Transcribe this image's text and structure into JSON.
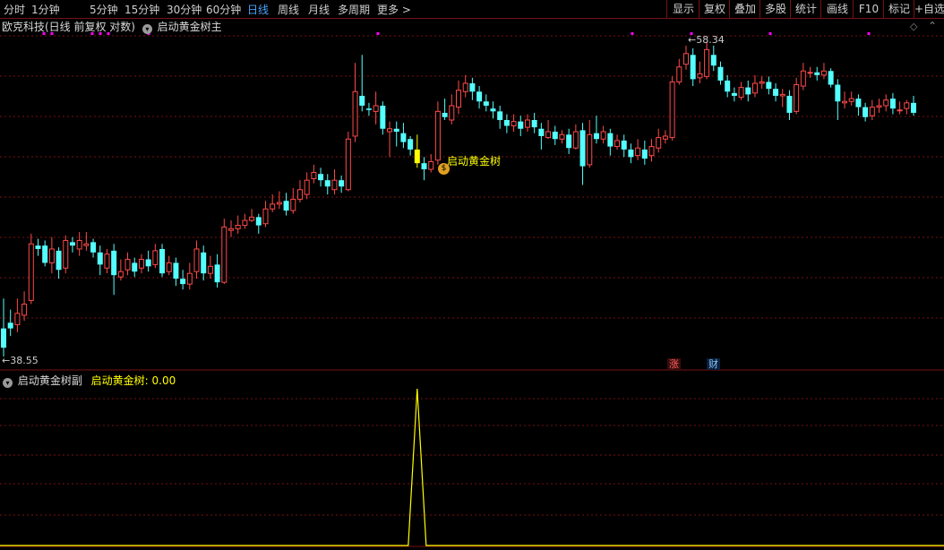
{
  "toolbar": {
    "periods": [
      "分时",
      "1分钟",
      "5分钟",
      "15分钟",
      "30分钟",
      "60分钟",
      "日线",
      "周线",
      "月线",
      "多周期",
      "更多 >"
    ],
    "active_period": "日线",
    "buttons": [
      "显示",
      "复权",
      "叠加",
      "多股",
      "统计",
      "画线",
      "F10",
      "标记",
      "+自选"
    ]
  },
  "main_chart": {
    "stock_title": "欧克科技(日线 前复权 对数)",
    "indicator_name": "启动黄金树主",
    "high_label": "58.34",
    "low_label": "38.55",
    "signal_text": "启动黄金树",
    "tags": [
      "涨",
      "财"
    ]
  },
  "sub_chart": {
    "indicator_name": "启动黄金树副",
    "value_label": "启动黄金树: 0.00"
  },
  "colors": {
    "up": "#ff4a4a",
    "down": "#54ffff",
    "signal": "#ffff00",
    "grid": "#7a1010",
    "marker": "#ff00ff"
  },
  "chart_data": {
    "type": "candlestick",
    "price_range": [
      38.55,
      58.34
    ],
    "candles": [
      [
        40.0,
        39.0,
        41.6,
        38.55
      ],
      [
        40.3,
        40.0,
        41.0,
        39.6
      ],
      [
        40.2,
        40.8,
        41.6,
        39.8
      ],
      [
        40.7,
        41.3,
        42.0,
        40.4
      ],
      [
        41.5,
        44.7,
        45.3,
        41.3
      ],
      [
        44.6,
        44.4,
        45.0,
        44.0
      ],
      [
        44.6,
        43.6,
        44.9,
        43.4
      ],
      [
        43.6,
        44.4,
        45.1,
        43.0
      ],
      [
        44.3,
        43.2,
        44.5,
        42.7
      ],
      [
        43.3,
        44.9,
        45.2,
        43.0
      ],
      [
        44.8,
        44.6,
        45.1,
        44.2
      ],
      [
        44.4,
        44.9,
        45.4,
        44.0
      ],
      [
        44.6,
        44.7,
        45.4,
        44.3
      ],
      [
        44.8,
        44.2,
        45.0,
        43.9
      ],
      [
        44.2,
        43.5,
        44.6,
        42.9
      ],
      [
        43.3,
        44.1,
        44.4,
        43.0
      ],
      [
        44.3,
        42.9,
        44.7,
        41.8
      ],
      [
        42.8,
        43.1,
        43.8,
        42.6
      ],
      [
        43.2,
        43.8,
        44.2,
        42.9
      ],
      [
        43.6,
        43.1,
        43.9,
        42.8
      ],
      [
        43.3,
        43.8,
        44.1,
        43.0
      ],
      [
        43.8,
        43.4,
        44.3,
        43.1
      ],
      [
        43.5,
        44.3,
        44.7,
        43.3
      ],
      [
        44.4,
        43.0,
        44.7,
        42.8
      ],
      [
        43.1,
        43.6,
        44.0,
        42.9
      ],
      [
        43.6,
        42.7,
        43.9,
        42.3
      ],
      [
        42.7,
        42.4,
        43.2,
        42.1
      ],
      [
        42.4,
        43.0,
        43.6,
        42.1
      ],
      [
        43.1,
        44.4,
        44.9,
        42.7
      ],
      [
        44.2,
        43.0,
        44.6,
        42.6
      ],
      [
        43.0,
        43.4,
        44.0,
        42.7
      ],
      [
        43.5,
        42.5,
        44.1,
        42.2
      ],
      [
        42.5,
        45.7,
        46.2,
        42.4
      ],
      [
        45.5,
        45.6,
        46.1,
        45.1
      ],
      [
        45.6,
        45.8,
        46.4,
        45.3
      ],
      [
        45.8,
        46.1,
        46.5,
        45.6
      ],
      [
        46.1,
        46.3,
        46.8,
        46.0
      ],
      [
        46.3,
        45.8,
        46.5,
        45.3
      ],
      [
        45.9,
        46.8,
        47.3,
        45.7
      ],
      [
        46.8,
        47.1,
        47.7,
        46.6
      ],
      [
        47.1,
        47.2,
        47.9,
        46.8
      ],
      [
        47.3,
        46.7,
        47.8,
        46.4
      ],
      [
        46.7,
        47.4,
        48.1,
        46.5
      ],
      [
        47.4,
        48.0,
        48.6,
        47.2
      ],
      [
        47.7,
        48.6,
        49.1,
        47.4
      ],
      [
        48.7,
        49.1,
        49.6,
        48.4
      ],
      [
        49.0,
        48.6,
        49.4,
        48.2
      ],
      [
        48.6,
        48.2,
        49.0,
        47.7
      ],
      [
        48.0,
        48.6,
        49.3,
        47.7
      ],
      [
        48.6,
        48.2,
        48.9,
        47.8
      ],
      [
        48.0,
        51.3,
        51.8,
        47.9
      ],
      [
        51.5,
        54.6,
        56.7,
        51.1
      ],
      [
        54.3,
        53.6,
        57.3,
        53.2
      ],
      [
        53.4,
        53.3,
        53.8,
        52.9
      ],
      [
        53.2,
        53.6,
        54.6,
        52.3
      ],
      [
        53.6,
        52.0,
        53.9,
        51.6
      ],
      [
        51.8,
        52.0,
        52.5,
        50.1
      ],
      [
        52.0,
        51.8,
        52.5,
        50.8
      ],
      [
        51.7,
        51.1,
        52.4,
        50.7
      ],
      [
        51.3,
        50.6,
        51.5,
        50.2
      ],
      [
        50.6,
        49.7,
        51.6,
        49.4
      ],
      [
        49.7,
        49.3,
        50.1,
        48.6
      ],
      [
        49.3,
        49.8,
        50.3,
        49.1
      ],
      [
        49.9,
        53.2,
        53.9,
        49.6
      ],
      [
        53.1,
        52.8,
        54.1,
        52.6
      ],
      [
        52.6,
        53.6,
        54.4,
        52.3
      ],
      [
        53.5,
        54.7,
        55.4,
        53.0
      ],
      [
        54.6,
        55.2,
        55.8,
        54.2
      ],
      [
        55.2,
        54.6,
        55.6,
        54.0
      ],
      [
        54.6,
        53.9,
        55.0,
        53.4
      ],
      [
        53.9,
        53.6,
        54.4,
        53.2
      ],
      [
        53.4,
        53.2,
        53.9,
        52.7
      ],
      [
        53.2,
        52.6,
        53.6,
        52.0
      ],
      [
        52.6,
        52.2,
        53.0,
        51.7
      ],
      [
        52.2,
        52.5,
        53.0,
        51.8
      ],
      [
        52.5,
        52.0,
        52.9,
        51.5
      ],
      [
        52.1,
        52.6,
        53.0,
        51.8
      ],
      [
        52.6,
        52.1,
        53.1,
        51.7
      ],
      [
        52.0,
        51.5,
        52.4,
        50.6
      ],
      [
        51.4,
        51.8,
        52.6,
        51.3
      ],
      [
        51.8,
        51.3,
        52.2,
        50.9
      ],
      [
        51.3,
        51.6,
        51.9,
        51.0
      ],
      [
        51.6,
        50.7,
        52.0,
        50.3
      ],
      [
        50.7,
        51.8,
        52.3,
        50.6
      ],
      [
        51.9,
        49.5,
        52.4,
        48.3
      ],
      [
        49.6,
        51.6,
        52.6,
        49.4
      ],
      [
        51.7,
        51.3,
        52.9,
        51.0
      ],
      [
        51.3,
        51.8,
        52.2,
        51.0
      ],
      [
        51.7,
        50.8,
        52.0,
        50.2
      ],
      [
        50.8,
        51.2,
        51.6,
        50.6
      ],
      [
        51.2,
        50.6,
        51.6,
        50.1
      ],
      [
        50.6,
        50.1,
        51.0,
        49.7
      ],
      [
        50.2,
        50.7,
        51.3,
        49.9
      ],
      [
        50.6,
        50.0,
        51.2,
        49.6
      ],
      [
        50.2,
        50.8,
        51.3,
        49.8
      ],
      [
        50.7,
        51.4,
        52.0,
        50.4
      ],
      [
        51.3,
        51.5,
        51.9,
        51.0
      ],
      [
        51.4,
        55.3,
        55.7,
        51.2
      ],
      [
        55.3,
        56.4,
        57.0,
        55.1
      ],
      [
        56.6,
        57.4,
        58.0,
        56.2
      ],
      [
        57.3,
        55.5,
        57.8,
        55.0
      ],
      [
        55.6,
        55.9,
        56.8,
        55.2
      ],
      [
        55.7,
        57.7,
        58.3,
        55.5
      ],
      [
        57.3,
        56.5,
        58.0,
        56.1
      ],
      [
        56.4,
        55.4,
        56.8,
        55.1
      ],
      [
        55.4,
        54.6,
        55.8,
        54.2
      ],
      [
        54.5,
        54.3,
        54.9,
        53.9
      ],
      [
        54.2,
        54.9,
        55.3,
        54.0
      ],
      [
        54.9,
        54.4,
        55.4,
        53.9
      ],
      [
        54.5,
        55.2,
        55.8,
        54.2
      ],
      [
        55.2,
        55.3,
        55.7,
        54.8
      ],
      [
        55.3,
        54.8,
        55.7,
        54.4
      ],
      [
        54.8,
        54.3,
        55.2,
        53.9
      ],
      [
        54.3,
        54.4,
        54.8,
        53.5
      ],
      [
        54.3,
        53.1,
        54.7,
        52.6
      ],
      [
        53.2,
        55.1,
        55.6,
        53.0
      ],
      [
        55.0,
        56.1,
        56.7,
        54.7
      ],
      [
        56.0,
        56.0,
        56.4,
        55.6
      ],
      [
        56.0,
        55.8,
        56.4,
        55.4
      ],
      [
        55.8,
        56.1,
        56.7,
        55.5
      ],
      [
        56.1,
        55.1,
        56.3,
        54.9
      ],
      [
        55.1,
        53.9,
        55.5,
        52.6
      ],
      [
        53.8,
        53.9,
        54.6,
        53.4
      ],
      [
        53.9,
        54.1,
        54.6,
        53.6
      ],
      [
        54.1,
        53.5,
        54.4,
        52.9
      ],
      [
        53.5,
        52.8,
        53.8,
        52.5
      ],
      [
        52.9,
        53.5,
        54.0,
        52.6
      ],
      [
        53.5,
        53.6,
        54.1,
        53.1
      ],
      [
        53.6,
        54.0,
        54.4,
        53.2
      ],
      [
        54.1,
        53.4,
        54.5,
        53.0
      ],
      [
        53.3,
        53.3,
        53.9,
        53.0
      ],
      [
        53.4,
        53.8,
        54.0,
        53.0
      ],
      [
        53.8,
        53.1,
        54.3,
        52.9
      ]
    ],
    "signal_index": 60,
    "signal_series": {
      "name": "启动黄金树",
      "peak_index": 60,
      "peak_value": 1,
      "current_value": 0.0
    }
  }
}
